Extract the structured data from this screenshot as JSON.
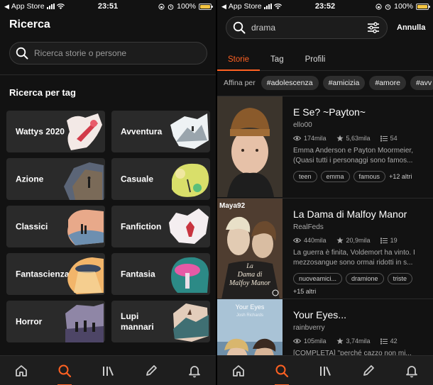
{
  "status_left": {
    "carrier": "App Store",
    "time": "23:51",
    "battery": "100%"
  },
  "status_right": {
    "carrier": "App Store",
    "time": "23:52",
    "battery": "100%"
  },
  "search_screen": {
    "title": "Ricerca",
    "search_placeholder": "Ricerca storie o persone",
    "section_title": "Ricerca per tag",
    "tags": [
      {
        "label": "Wattys 2020",
        "art": "wattys"
      },
      {
        "label": "Avventura",
        "art": "adventure"
      },
      {
        "label": "Azione",
        "art": "action"
      },
      {
        "label": "Casuale",
        "art": "random"
      },
      {
        "label": "Classici",
        "art": "classics"
      },
      {
        "label": "Fanfiction",
        "art": "fanfiction"
      },
      {
        "label": "Fantascienza",
        "art": "scifi"
      },
      {
        "label": "Fantasia",
        "art": "fantasy"
      },
      {
        "label": "Horror",
        "art": "horror"
      },
      {
        "label": "Lupi mannari",
        "art": "werewolf"
      }
    ]
  },
  "results_screen": {
    "query": "drama",
    "cancel_label": "Annulla",
    "tabs": [
      {
        "label": "Storie",
        "active": true
      },
      {
        "label": "Tag",
        "active": false
      },
      {
        "label": "Profili",
        "active": false
      }
    ],
    "refine_label": "Affina per",
    "refine_chips": [
      "#adolescenza",
      "#amicizia",
      "#amore",
      "#avv"
    ],
    "stories": [
      {
        "title": "E Se?   ~Payton~",
        "author": "ello00",
        "reads": "174mila",
        "votes": "5,63mila",
        "parts": "54",
        "description": "Emma Anderson e Payton Moormeier, (Quasi tutti i personaggi sono famos...",
        "tags": [
          "teen",
          "emma",
          "famous"
        ],
        "more": "+12 altri",
        "cover": "beanie"
      },
      {
        "title": "La Dama di Malfoy Manor",
        "author": "RealFeds",
        "reads": "440mila",
        "votes": "20,9mila",
        "parts": "19",
        "description": "La guerra è finita, Voldemort ha vinto. I mezzosangue sono ormai ridotti in s...",
        "tags": [
          "nuoveamici...",
          "dramione",
          "triste"
        ],
        "more": "+15 altri",
        "cover": "malfoy",
        "cover_caption": "Maya92",
        "cover_title": "La Dama di Malfoy Manor"
      },
      {
        "title": "Your Eyes...",
        "author": "rainbverry",
        "reads": "105mila",
        "votes": "3,74mila",
        "parts": "42",
        "description": "[COMPLETA] \"perché cazzo non mi...",
        "tags": [],
        "more": "",
        "cover": "youreyes",
        "cover_title": "Your Eyes",
        "cover_sub": "Josh Richards"
      }
    ]
  },
  "accent": "#ff6122"
}
